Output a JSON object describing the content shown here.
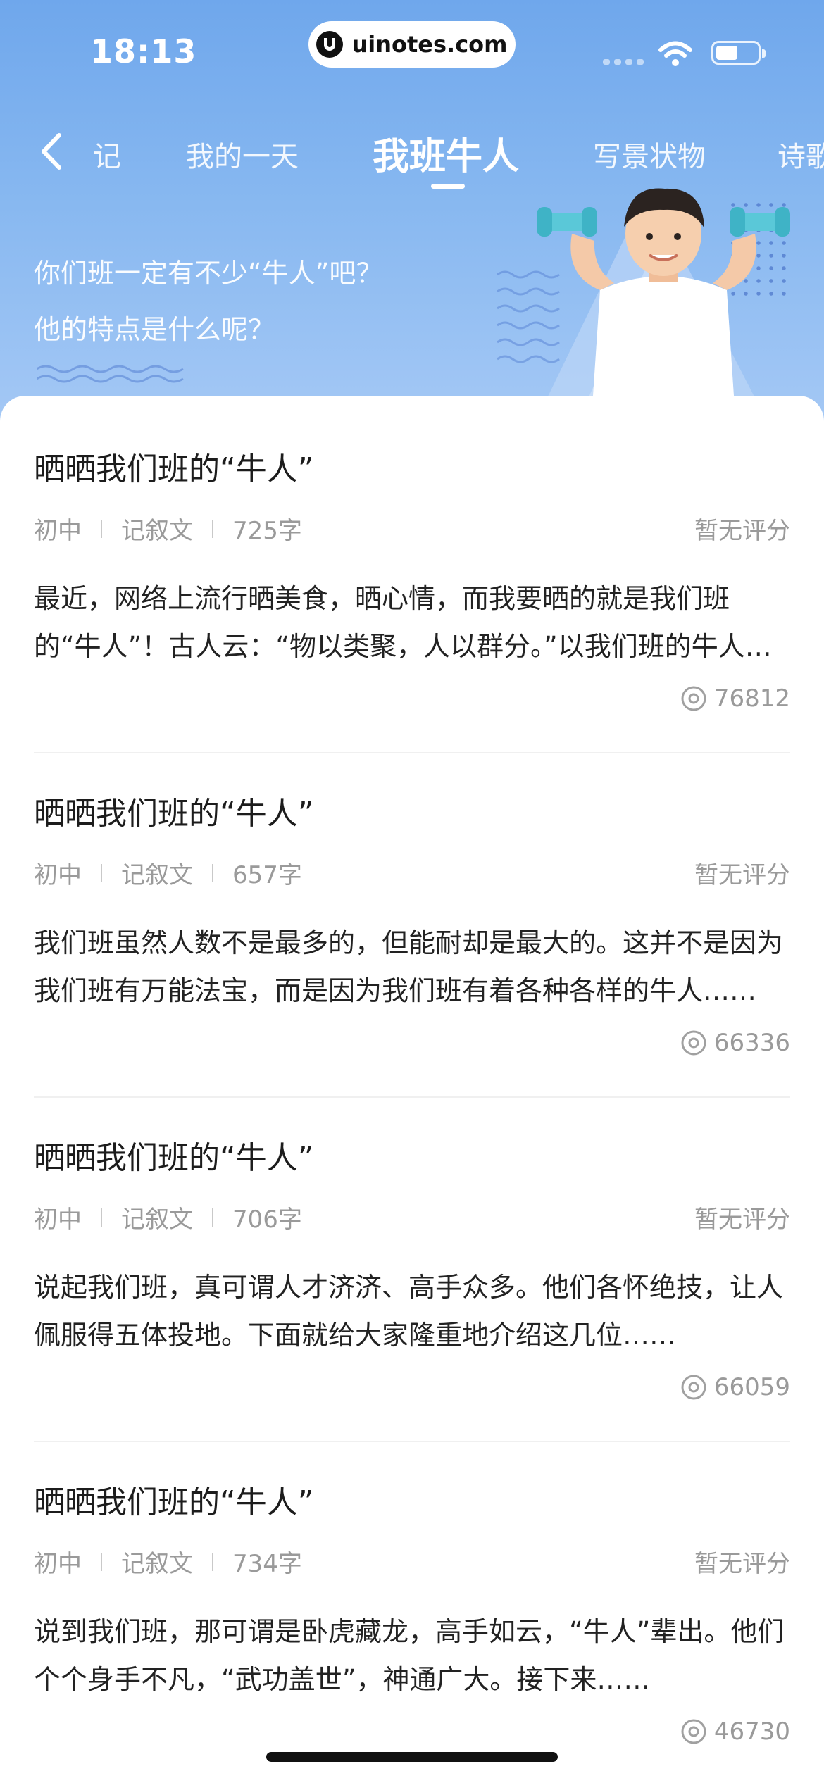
{
  "status_bar": {
    "time": "18:13",
    "url": "uinotes.com"
  },
  "nav": {
    "back_icon": "chevron-left-icon",
    "tabs": [
      {
        "label": "记"
      },
      {
        "label": "我的一天"
      },
      {
        "label": "我班牛人"
      },
      {
        "label": "写景状物"
      },
      {
        "label": "诗歌"
      }
    ],
    "active_tab": 2
  },
  "hero": {
    "prompt": "你们班一定有不少“牛人”吧？他的特点是什么呢？"
  },
  "articles": [
    {
      "title": "晒晒我们班的“牛人”",
      "grade": "初中",
      "genre": "记叙文",
      "word_count": "725字",
      "rating": "暂无评分",
      "excerpt": "最近，网络上流行晒美食，晒心情，而我要晒的就是我们班的“牛人”！古人云：“物以类聚，人以群分。”以我们班的牛人为例……",
      "views": "76812"
    },
    {
      "title": "晒晒我们班的“牛人”",
      "grade": "初中",
      "genre": "记叙文",
      "word_count": "657字",
      "rating": "暂无评分",
      "excerpt": "我们班虽然人数不是最多的，但能耐却是最大的。这并不是因为我们班有万能法宝，而是因为我们班有着各种各样的牛人……",
      "views": "66336"
    },
    {
      "title": "晒晒我们班的“牛人”",
      "grade": "初中",
      "genre": "记叙文",
      "word_count": "706字",
      "rating": "暂无评分",
      "excerpt": "说起我们班，真可谓人才济济、高手众多。他们各怀绝技，让人佩服得五体投地。下面就给大家隆重地介绍这几位……",
      "views": "66059"
    },
    {
      "title": "晒晒我们班的“牛人”",
      "grade": "初中",
      "genre": "记叙文",
      "word_count": "734字",
      "rating": "暂无评分",
      "excerpt": "说到我们班，那可谓是卧虎藏龙，高手如云，“牛人”辈出。他们个个身手不凡，“武功盖世”，神通广大。接下来……",
      "views": "46730"
    }
  ],
  "colors": {
    "hero_top": "#6fa7ec",
    "hero_bottom": "#a4c8f5",
    "meta_gray": "#9a9a9a",
    "text_dark": "#1c1c1c"
  }
}
